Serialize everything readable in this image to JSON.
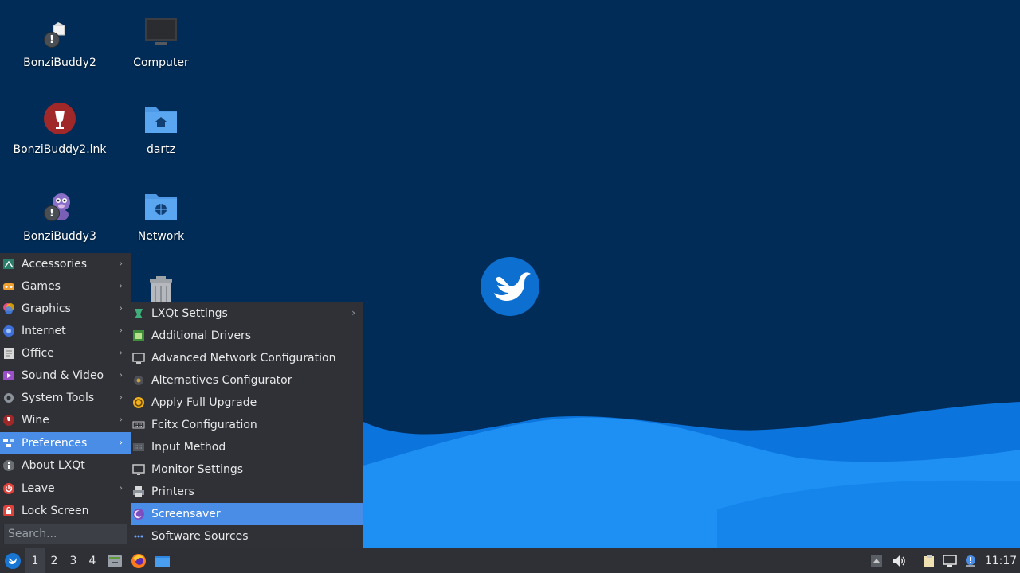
{
  "desktop": {
    "icons": [
      {
        "label": "BonziBuddy2"
      },
      {
        "label": "Computer"
      },
      {
        "label": "BonziBuddy2.lnk"
      },
      {
        "label": "dartz"
      },
      {
        "label": "BonziBuddy3"
      },
      {
        "label": "Network"
      }
    ],
    "warning_badge": "!"
  },
  "main_menu": {
    "items": [
      {
        "label": "Accessories",
        "icon": "accessories-icon"
      },
      {
        "label": "Games",
        "icon": "games-icon"
      },
      {
        "label": "Graphics",
        "icon": "graphics-icon"
      },
      {
        "label": "Internet",
        "icon": "internet-icon"
      },
      {
        "label": "Office",
        "icon": "office-icon"
      },
      {
        "label": "Sound & Video",
        "icon": "sound-video-icon"
      },
      {
        "label": "System Tools",
        "icon": "system-tools-icon"
      },
      {
        "label": "Wine",
        "icon": "wine-icon"
      },
      {
        "label": "Preferences",
        "icon": "preferences-icon",
        "active": true
      },
      {
        "label": "About LXQt",
        "icon": "info-icon"
      },
      {
        "label": "Leave",
        "icon": "power-icon"
      },
      {
        "label": "Lock Screen",
        "icon": "lock-icon"
      }
    ],
    "search_placeholder": "Search..."
  },
  "preferences_menu": {
    "items": [
      {
        "label": "LXQt Settings"
      },
      {
        "label": "Additional Drivers"
      },
      {
        "label": "Advanced Network Configuration"
      },
      {
        "label": "Alternatives Configurator"
      },
      {
        "label": "Apply Full Upgrade"
      },
      {
        "label": "Fcitx Configuration"
      },
      {
        "label": "Input Method"
      },
      {
        "label": "Monitor Settings"
      },
      {
        "label": "Printers"
      },
      {
        "label": "Screensaver",
        "active": true
      },
      {
        "label": "Software Sources"
      }
    ]
  },
  "taskbar": {
    "desktops": [
      "1",
      "2",
      "3",
      "4"
    ],
    "current_desktop": "1",
    "clock": "11:17"
  },
  "colors": {
    "desktop_bg": "#012c57",
    "wave_light": "#1a8cf0",
    "wave_mid": "#0a6fd8",
    "menu_bg": "#2f3137",
    "highlight": "#4a8de6",
    "taskbar_bg": "#2e3036"
  }
}
